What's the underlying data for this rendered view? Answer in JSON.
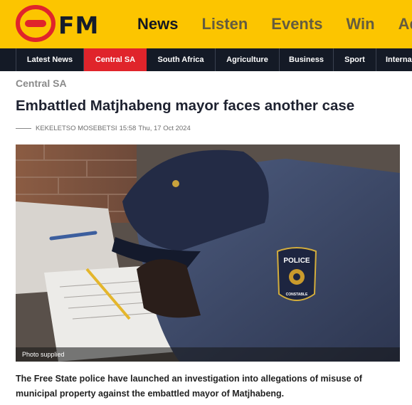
{
  "brand": {
    "logo_text": "FM",
    "colors": {
      "header_bg": "#fcc500",
      "logo_red": "#e0242b",
      "nav_dark": "#141a26",
      "active_tab": "#e0242b"
    }
  },
  "main_nav": {
    "items": [
      {
        "label": "News"
      },
      {
        "label": "Listen"
      },
      {
        "label": "Events"
      },
      {
        "label": "Win"
      },
      {
        "label": "Adv"
      }
    ]
  },
  "category_nav": {
    "items": [
      {
        "label": "Latest News"
      },
      {
        "label": "Central SA",
        "active": true
      },
      {
        "label": "South Africa"
      },
      {
        "label": "Agriculture"
      },
      {
        "label": "Business"
      },
      {
        "label": "Sport"
      },
      {
        "label": "Interna"
      }
    ]
  },
  "article": {
    "section": "Central SA",
    "title": "Embattled Matjhabeng mayor faces another case",
    "author": "KEKELETSO MOSEBETSI",
    "time": "15:58",
    "date": "Thu, 17 Oct 2024",
    "image": {
      "caption": "Photo supplied",
      "badge_text": "POLICE",
      "badge_subtext": "CONSTABLE"
    },
    "lead": "The Free State police have launched an investigation into allegations of misuse of municipal property against the embattled mayor of Matjhabeng."
  }
}
